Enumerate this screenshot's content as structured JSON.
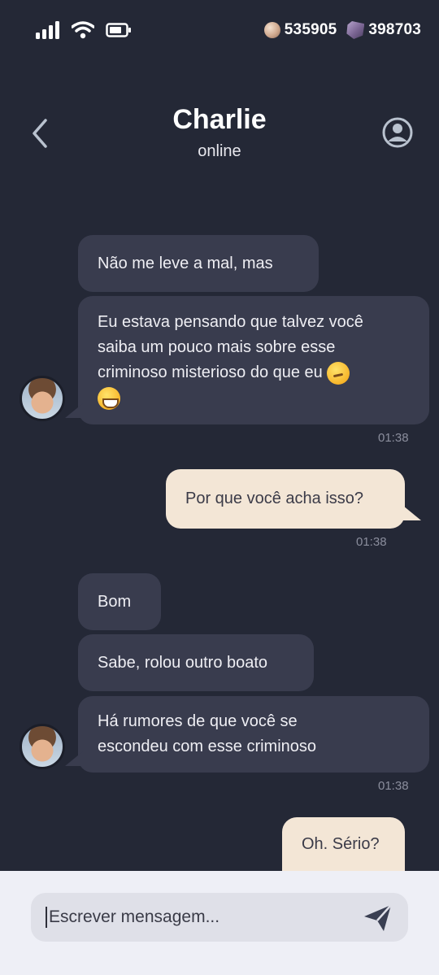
{
  "status": {
    "signal_icon": "signal-bars-icon",
    "wifi_icon": "wifi-icon",
    "battery_icon": "battery-icon",
    "coins": "535905",
    "gems": "398703"
  },
  "header": {
    "title": "Charlie",
    "subtitle": "online"
  },
  "messages": [
    {
      "dir": "in",
      "text": "Não me leve a mal, mas"
    },
    {
      "dir": "in",
      "text_lines": [
        "Eu estava pensando que talvez você",
        "saiba um pouco mais sobre esse",
        "criminoso misterioso do que eu"
      ],
      "emoji": [
        "thinking-face-icon",
        "grinning-sweat-icon"
      ],
      "time": "01:38"
    },
    {
      "dir": "out",
      "text": "Por que você acha isso?",
      "time": "01:38"
    },
    {
      "dir": "in",
      "text": "Bom"
    },
    {
      "dir": "in",
      "text": "Sabe, rolou outro boato"
    },
    {
      "dir": "in",
      "text_lines": [
        "Há rumores de que você se",
        "escondeu com esse criminoso"
      ],
      "time": "01:38"
    },
    {
      "dir": "out",
      "text": "Oh. Sério?"
    }
  ],
  "composer": {
    "placeholder": "Escrever mensagem...",
    "value": ""
  },
  "colors": {
    "background": "#242836",
    "incoming_bubble": "#393c4e",
    "outgoing_bubble": "#f3e6d6",
    "composer_bg": "#eeeff6"
  }
}
